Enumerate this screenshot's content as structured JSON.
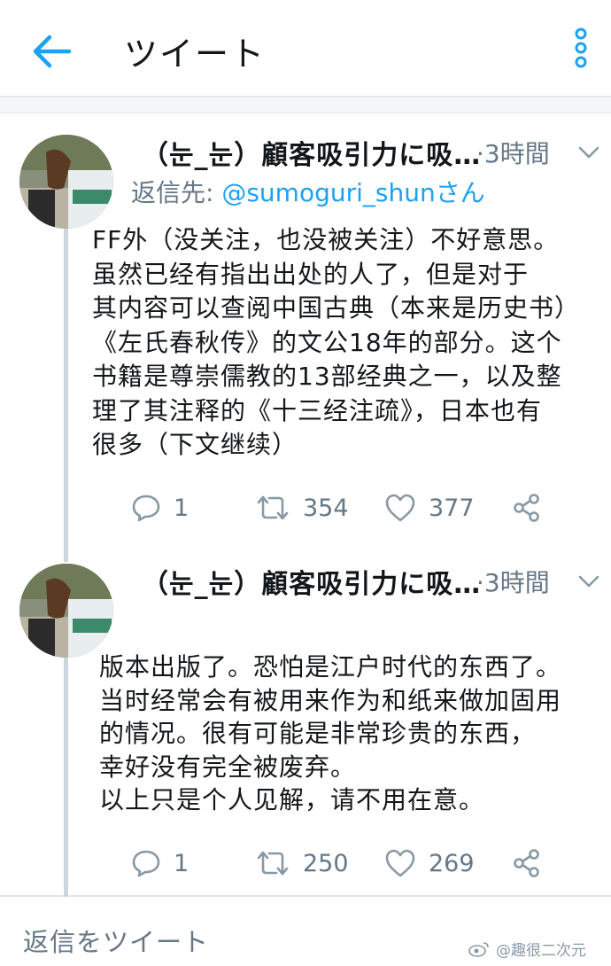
{
  "header": {
    "title": "ツイート"
  },
  "tweets": [
    {
      "display_name": "（눈_눈）顧客吸引力に吸…",
      "time": "·3時間",
      "reply_prefix": "返信先: ",
      "reply_handle": "@sumoguri_shunさん",
      "body_lines": [
        "FF外（没关注，也没被关注）不好意思。",
        "虽然已经有指出出处的人了，但是对于",
        "其内容可以查阅中国古典（本来是历史书）",
        "《左氏春秋传》的文公18年的部分。这个",
        "书籍是尊崇儒教的13部经典之一，以及整",
        "理了其注释的《十三经注疏》，日本也有",
        "很多（下文继续）"
      ],
      "reply_count": "1",
      "retweet_count": "354",
      "like_count": "377"
    },
    {
      "display_name": "（눈_눈）顧客吸引力に吸…",
      "time": "·3時間",
      "body_lines": [
        "版本出版了。恐怕是江户时代的东西了。",
        "当时经常会有被用来作为和纸来做加固用",
        "的情况。很有可能是非常珍贵的东西，",
        "幸好没有完全被废弃。",
        "以上只是个人见解，请不用在意。"
      ],
      "reply_count": "1",
      "retweet_count": "250",
      "like_count": "269"
    }
  ],
  "reply_bar": {
    "placeholder": "返信をツイート"
  },
  "watermark": {
    "text": "@趣很二次元"
  },
  "colors": {
    "accent": "#1da1f2",
    "secondary_text": "#657786",
    "divider": "#e1e8ed",
    "thread_line": "#ccd6dd"
  },
  "icons": [
    "back-arrow-icon",
    "more-vertical-icon",
    "chevron-down-icon",
    "reply-icon",
    "retweet-icon",
    "like-icon",
    "share-icon",
    "weibo-icon"
  ]
}
